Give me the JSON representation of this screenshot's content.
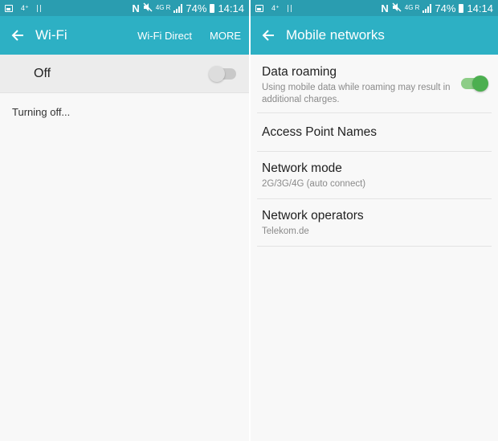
{
  "status_bar": {
    "left_text": "4⁺",
    "network": "4G R",
    "battery": "74%",
    "time": "14:14",
    "icons": [
      "image-notification-icon",
      "pause-notification-icon",
      "nfc-icon",
      "mute-icon",
      "signal-icon",
      "battery-icon"
    ]
  },
  "wifi_screen": {
    "title": "Wi-Fi",
    "actions": [
      "Wi-Fi Direct",
      "MORE"
    ],
    "master_toggle": {
      "label": "Off",
      "checked": false
    },
    "status": "Turning off..."
  },
  "mobile_screen": {
    "title": "Mobile networks",
    "items": [
      {
        "title": "Data roaming",
        "subtitle": "Using mobile data while roaming may result in additional charges.",
        "toggle": true
      },
      {
        "title": "Access Point Names"
      },
      {
        "title": "Network mode",
        "subtitle": "2G/3G/4G (auto connect)"
      },
      {
        "title": "Network operators",
        "subtitle": "Telekom.de"
      }
    ]
  },
  "colors": {
    "toolbar": "#2db0c4",
    "status_bar": "#2a9db0",
    "toggle_on": "#4caf50",
    "background": "#f8f8f8"
  }
}
